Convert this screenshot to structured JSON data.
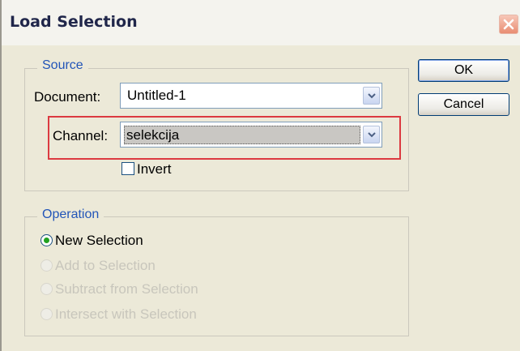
{
  "dialog": {
    "title": "Load Selection"
  },
  "source": {
    "group_label": "Source",
    "document_label": "Document:",
    "document_value": "Untitled-1",
    "channel_label": "Channel:",
    "channel_value": "selekcija",
    "invert_label": "Invert",
    "invert_checked": false
  },
  "operation": {
    "group_label": "Operation",
    "options": [
      {
        "label": "New Selection",
        "selected": true,
        "enabled": true
      },
      {
        "label": "Add to Selection",
        "selected": false,
        "enabled": false
      },
      {
        "label": "Subtract from Selection",
        "selected": false,
        "enabled": false
      },
      {
        "label": "Intersect with Selection",
        "selected": false,
        "enabled": false
      }
    ]
  },
  "buttons": {
    "ok": "OK",
    "cancel": "Cancel"
  },
  "colors": {
    "highlight": "#dc3a41",
    "group_title": "#2255b8",
    "dialog_bg": "#ece9d8"
  }
}
